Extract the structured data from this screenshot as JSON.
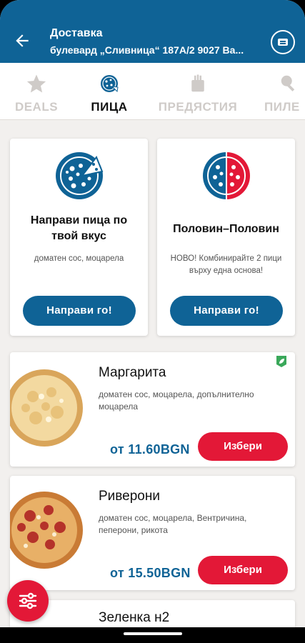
{
  "header": {
    "title": "Доставка",
    "address": "булевард „Сливница“ 187А/2 9027 Ва..."
  },
  "tabs": [
    {
      "label": "DEALS",
      "icon": "star-icon"
    },
    {
      "label": "ПИЦА",
      "icon": "pizza-icon"
    },
    {
      "label": "ПРЕДЯСТИЯ",
      "icon": "starter-icon"
    },
    {
      "label": "ПИЛЕ",
      "icon": "chicken-icon"
    }
  ],
  "promos": [
    {
      "title": "Направи пица по твой вкус",
      "desc": "доматен сос, моцарела",
      "button": "Направи го!"
    },
    {
      "title": "Половин–Половин",
      "desc": "НОВО! Комбинирайте 2 пици върху една основа!",
      "button": "Направи го!"
    }
  ],
  "products": [
    {
      "name": "Маргарита",
      "desc": "доматен сос, моцарела, допълнително моцарела",
      "price": "от 11.60BGN",
      "button": "Избери",
      "vegetarian": true
    },
    {
      "name": "Риверони",
      "desc": "доматен сос, моцарела, Вентричина, пеперони, рикота",
      "price": "от 15.50BGN",
      "button": "Избери",
      "vegetarian": false
    },
    {
      "name": "Зеленка н2",
      "desc": "",
      "price": "",
      "button": "",
      "vegetarian": false
    }
  ],
  "colors": {
    "brand_blue": "#0f6396",
    "brand_red": "#e31837"
  }
}
